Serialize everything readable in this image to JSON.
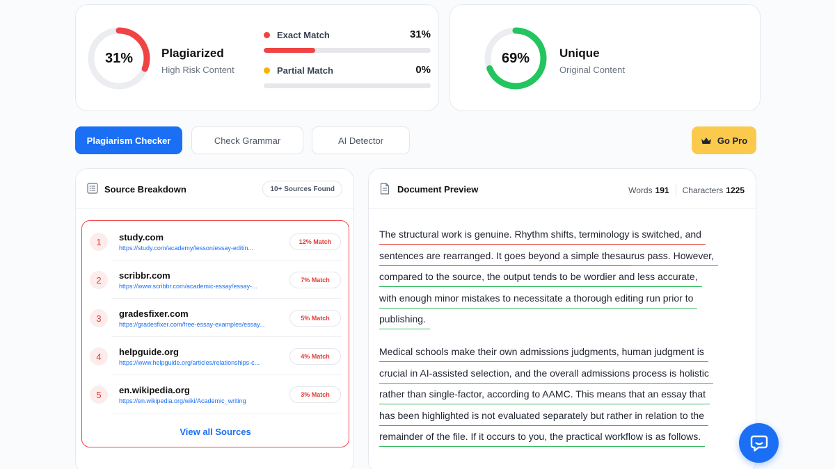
{
  "summary": {
    "plagiarized": {
      "percent_label": "31%",
      "percent": 31,
      "title": "Plagiarized",
      "subtitle": "High Risk Content",
      "color": "#ef4444"
    },
    "unique": {
      "percent_label": "69%",
      "percent": 69,
      "title": "Unique",
      "subtitle": "Original Content",
      "color": "#22c55e"
    },
    "matches": [
      {
        "label": "Exact Match",
        "value_label": "31%",
        "fraction": 0.31,
        "dot_color": "#ef4444"
      },
      {
        "label": "Partial Match",
        "value_label": "0%",
        "fraction": 0.0,
        "dot_color": "#f5b400"
      }
    ]
  },
  "tabs": [
    {
      "label": "Plagiarism Checker",
      "active": true
    },
    {
      "label": "Check Grammar",
      "active": false
    },
    {
      "label": "AI Detector",
      "active": false
    }
  ],
  "go_pro": {
    "label": "Go Pro",
    "icon": "crown-icon"
  },
  "sources": {
    "title": "Source Breakdown",
    "badge": "10+ Sources Found",
    "items": [
      {
        "num": "1",
        "domain": "study.com",
        "url": "https://study.com/academy/lesson/essay-editin...",
        "match": "12% Match"
      },
      {
        "num": "2",
        "domain": "scribbr.com",
        "url": "https://www.scribbr.com/academic-essay/essay-...",
        "match": "7% Match"
      },
      {
        "num": "3",
        "domain": "gradesfixer.com",
        "url": "https://gradesfixer.com/free-essay-examples/essay...",
        "match": "5% Match"
      },
      {
        "num": "4",
        "domain": "helpguide.org",
        "url": "https://www.helpguide.org/articles/relationships-c...",
        "match": "4% Match"
      },
      {
        "num": "5",
        "domain": "en.wikipedia.org",
        "url": "https://en.wikipedia.org/wiki/Academic_writing",
        "match": "3% Match"
      }
    ],
    "view_all": "View all Sources"
  },
  "document": {
    "title": "Document Preview",
    "words_label": "Words",
    "words": "191",
    "chars_label": "Characters",
    "chars": "1225",
    "paragraphs": [
      [
        {
          "text": "The structural work is genuine. Rhythm shifts, terminology is switched, and",
          "highlight": "red"
        },
        {
          "text": "sentences are rearranged. It goes beyond a simple thesaurus pass. However,",
          "highlight": "mixed"
        },
        {
          "text": "compared to the source, the output tends to be wordier and less accurate,",
          "highlight": "green"
        },
        {
          "text": "with enough minor mistakes to necessitate a thorough editing run prior to",
          "highlight": "green"
        },
        {
          "text": "publishing.",
          "highlight": "green"
        }
      ],
      [
        {
          "text": "Medical schools make their own admissions judgments, human judgment is",
          "highlight": "green"
        },
        {
          "text": "crucial in AI-assisted selection, and the overall admissions process is holistic",
          "highlight": "green"
        },
        {
          "text": "rather than single-factor, according to AAMC. This means that an essay that",
          "highlight": "green"
        },
        {
          "text": "has been highlighted is not evaluated separately but rather in relation to the",
          "highlight": "green"
        },
        {
          "text": "remainder of the file. If it occurs to you, the practical workflow is as follows.",
          "highlight": "green"
        }
      ]
    ]
  },
  "chat": {
    "icon": "chat-bubble-icon"
  }
}
